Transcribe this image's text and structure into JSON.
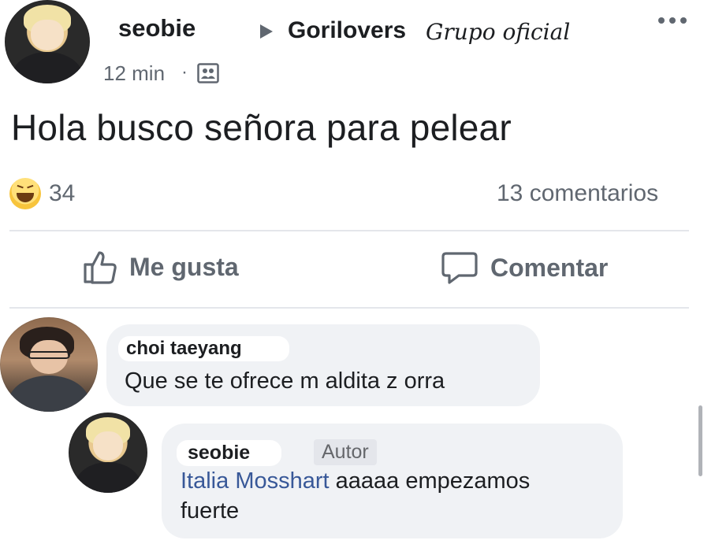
{
  "post": {
    "author": "seobie",
    "group_name": "Gorilovers",
    "group_suffix": "Grupo oficial",
    "time": "12 min",
    "separator": "·",
    "privacy_icon": "group-audience-icon",
    "menu_icon": "more-options-icon",
    "text": "Hola busco señora para pelear",
    "reaction_icon": "haha-reaction-icon",
    "reaction_count": "34",
    "comment_count": "13 comentarios"
  },
  "actions": {
    "like_label": "Me gusta",
    "like_icon": "thumbs-up-icon",
    "comment_label": "Comentar",
    "comment_icon": "comment-bubble-icon"
  },
  "comments": [
    {
      "author": "choi taeyang",
      "text": "Que se te ofrece m aldita z orra"
    },
    {
      "author": "seobie",
      "badge": "Autor",
      "mention": "Italia Mosshart",
      "text_line1": " aaaaa empezamos",
      "text_line2": "fuerte"
    }
  ],
  "colors": {
    "text": "#1c1e21",
    "muted": "#606770",
    "mention": "#385898",
    "bubble": "#f0f2f5",
    "divider": "#e4e6eb"
  }
}
